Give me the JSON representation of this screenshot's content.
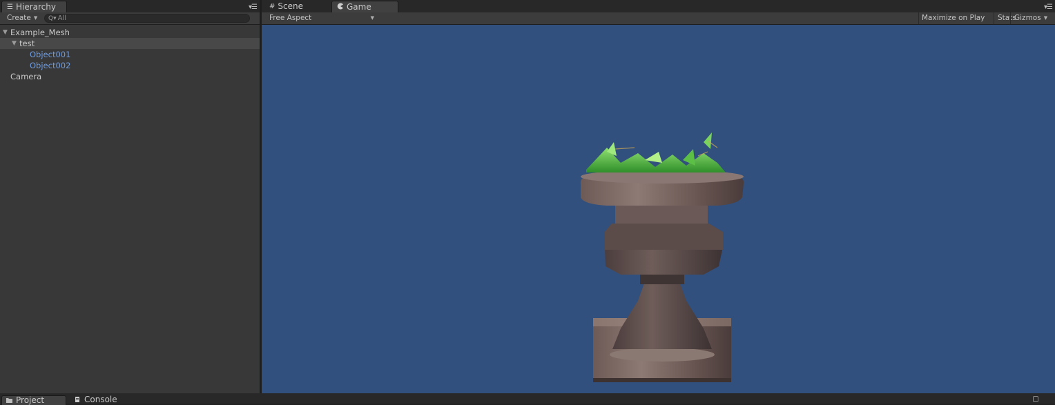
{
  "hierarchy": {
    "tab_label": "Hierarchy",
    "create_label": "Create",
    "search_placeholder": "All",
    "items": [
      {
        "label": "Example_Mesh",
        "expanded": true
      },
      {
        "label": "test",
        "expanded": true,
        "selected": true
      },
      {
        "label": "Object001",
        "prefab": true
      },
      {
        "label": "Object002",
        "prefab": true
      },
      {
        "label": "Camera"
      }
    ]
  },
  "game_panel": {
    "tabs": [
      {
        "label": "Scene",
        "icon": "grid-icon"
      },
      {
        "label": "Game",
        "icon": "pacman-icon",
        "active": true
      }
    ],
    "aspect_label": "Free Aspect",
    "maximize_label": "Maximize on Play",
    "stats_label": "Stats",
    "gizmos_label": "Gizmos",
    "background_color": "#31507d"
  },
  "bottom_tabs": [
    {
      "label": "Project",
      "icon": "folder-icon",
      "active": true
    },
    {
      "label": "Console",
      "icon": "console-icon"
    }
  ]
}
